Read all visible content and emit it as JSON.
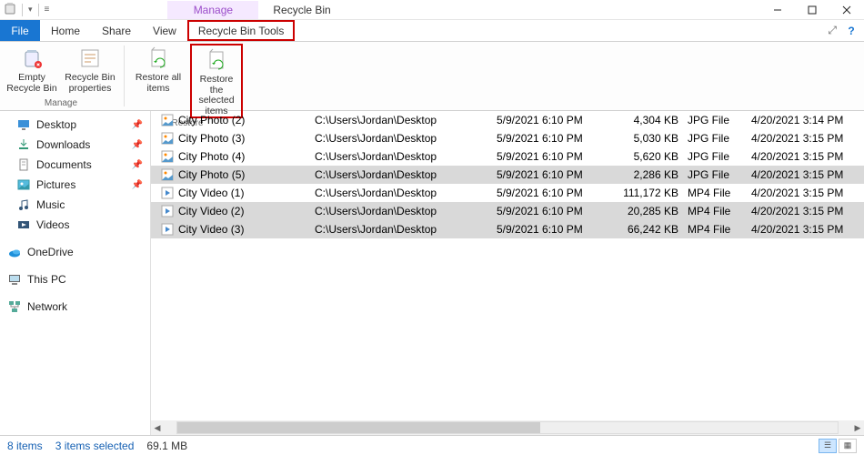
{
  "window": {
    "manage_label": "Manage",
    "title": "Recycle Bin"
  },
  "tabs": {
    "file": "File",
    "home": "Home",
    "share": "Share",
    "view": "View",
    "recycle_bin_tools": "Recycle Bin Tools"
  },
  "ribbon": {
    "empty": "Empty Recycle Bin",
    "props": "Recycle Bin properties",
    "restore_all": "Restore all items",
    "restore_sel": "Restore the selected items",
    "group_manage": "Manage",
    "group_restore": "Restore"
  },
  "nav": {
    "desktop": "Desktop",
    "downloads": "Downloads",
    "documents": "Documents",
    "pictures": "Pictures",
    "music": "Music",
    "videos": "Videos",
    "onedrive": "OneDrive",
    "thispc": "This PC",
    "network": "Network"
  },
  "files": [
    {
      "name": "City Photo (2)",
      "loc": "C:\\Users\\Jordan\\Desktop",
      "del": "5/9/2021 6:10 PM",
      "size": "4,304 KB",
      "type": "JPG File",
      "mod": "4/20/2021 3:14 PM",
      "kind": "jpg",
      "selected": false
    },
    {
      "name": "City Photo (3)",
      "loc": "C:\\Users\\Jordan\\Desktop",
      "del": "5/9/2021 6:10 PM",
      "size": "5,030 KB",
      "type": "JPG File",
      "mod": "4/20/2021 3:15 PM",
      "kind": "jpg",
      "selected": false
    },
    {
      "name": "City Photo (4)",
      "loc": "C:\\Users\\Jordan\\Desktop",
      "del": "5/9/2021 6:10 PM",
      "size": "5,620 KB",
      "type": "JPG File",
      "mod": "4/20/2021 3:15 PM",
      "kind": "jpg",
      "selected": false
    },
    {
      "name": "City Photo (5)",
      "loc": "C:\\Users\\Jordan\\Desktop",
      "del": "5/9/2021 6:10 PM",
      "size": "2,286 KB",
      "type": "JPG File",
      "mod": "4/20/2021 3:15 PM",
      "kind": "jpg",
      "selected": true
    },
    {
      "name": "City Video (1)",
      "loc": "C:\\Users\\Jordan\\Desktop",
      "del": "5/9/2021 6:10 PM",
      "size": "111,172 KB",
      "type": "MP4 File",
      "mod": "4/20/2021 3:15 PM",
      "kind": "mp4",
      "selected": false
    },
    {
      "name": "City Video (2)",
      "loc": "C:\\Users\\Jordan\\Desktop",
      "del": "5/9/2021 6:10 PM",
      "size": "20,285 KB",
      "type": "MP4 File",
      "mod": "4/20/2021 3:15 PM",
      "kind": "mp4",
      "selected": true
    },
    {
      "name": "City Video (3)",
      "loc": "C:\\Users\\Jordan\\Desktop",
      "del": "5/9/2021 6:10 PM",
      "size": "66,242 KB",
      "type": "MP4 File",
      "mod": "4/20/2021 3:15 PM",
      "kind": "mp4",
      "selected": true
    }
  ],
  "status": {
    "count": "8 items",
    "selected": "3 items selected",
    "size": "69.1 MB"
  }
}
